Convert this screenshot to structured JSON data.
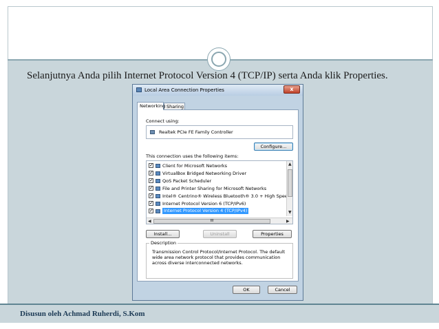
{
  "slide": {
    "text": "Selanjutnya Anda pilih Internet Protocol Version 4 (TCP/IP) serta Anda klik Properties.",
    "footer": "Disusun oleh Achmad Ruherdi, S.Kom"
  },
  "dialog": {
    "title": "Local Area Connection Properties",
    "close_glyph": "x",
    "tabs": [
      "Networking",
      "Sharing"
    ],
    "connect_using_label": "Connect using:",
    "adapter_name": "Realtek PCIe FE Family Controller",
    "configure_button": "Configure...",
    "items_label": "This connection uses the following items:",
    "items": [
      {
        "label": "Client for Microsoft Networks",
        "checked": true
      },
      {
        "label": "VirtualBox Bridged Networking Driver",
        "checked": true
      },
      {
        "label": "QoS Packet Scheduler",
        "checked": true
      },
      {
        "label": "File and Printer Sharing for Microsoft Networks",
        "checked": true
      },
      {
        "label": "Intel® Centrino® Wireless Bluetooth® 3.0 + High Spee",
        "checked": true
      },
      {
        "label": "Internet Protocol Version 6 (TCP/IPv6)",
        "checked": true
      },
      {
        "label": "Internet Protocol Version 4 (TCP/IPv4)",
        "checked": true,
        "selected": true
      }
    ],
    "check_glyph": "✓",
    "hscroll_thumb": "III",
    "install_button": "Install...",
    "uninstall_button": "Uninstall",
    "properties_button": "Properties",
    "description_title": "Description",
    "description_text": "Transmission Control Protocol/Internet Protocol. The default wide area network protocol that provides communication across diverse interconnected networks.",
    "ok_button": "OK",
    "cancel_button": "Cancel"
  },
  "colors": {
    "slide_body": "#c9d6db",
    "accent": "#8aa6b0",
    "selection": "#3399ff"
  }
}
